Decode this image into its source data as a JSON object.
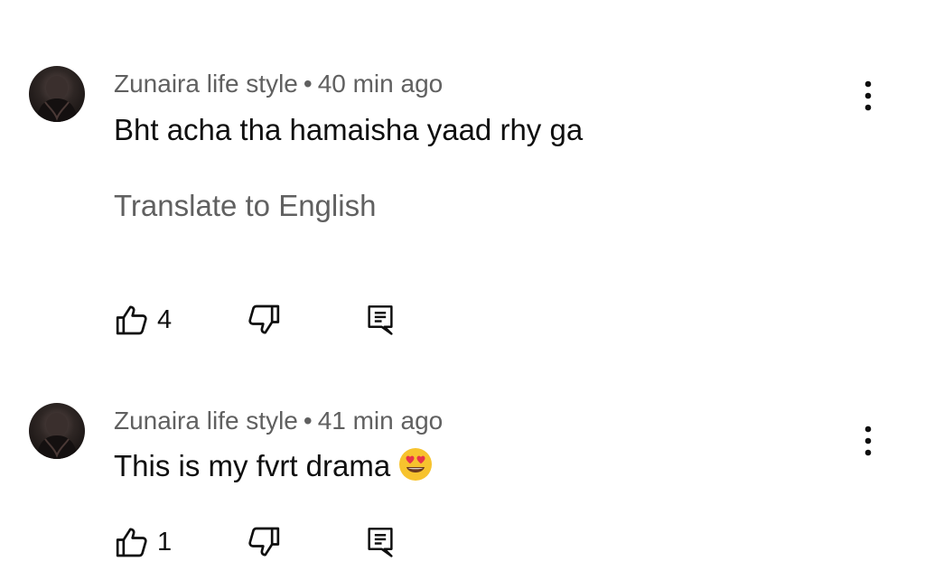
{
  "comments": [
    {
      "author": "Zunaira life style",
      "separator": "•",
      "time": "40 min ago",
      "text": "Bht acha tha hamaisha yaad rhy ga",
      "translate_label": "Translate to English",
      "likes": "4",
      "icons": {
        "menu": "more-vertical-icon",
        "like": "thumbs-up-icon",
        "dislike": "thumbs-down-icon",
        "reply": "reply-comment-icon"
      }
    },
    {
      "author": "Zunaira life style",
      "separator": "•",
      "time": "41 min ago",
      "text": "This is my fvrt drama",
      "emoji": "heart-eyes-emoji",
      "likes": "1",
      "icons": {
        "menu": "more-vertical-icon",
        "like": "thumbs-up-icon",
        "dislike": "thumbs-down-icon",
        "reply": "reply-comment-icon"
      }
    }
  ],
  "colors": {
    "primary_text": "#0f0f0f",
    "secondary_text": "#606060",
    "background": "#ffffff",
    "emoji_face": "#f7c32e",
    "emoji_heart": "#e8344a"
  }
}
